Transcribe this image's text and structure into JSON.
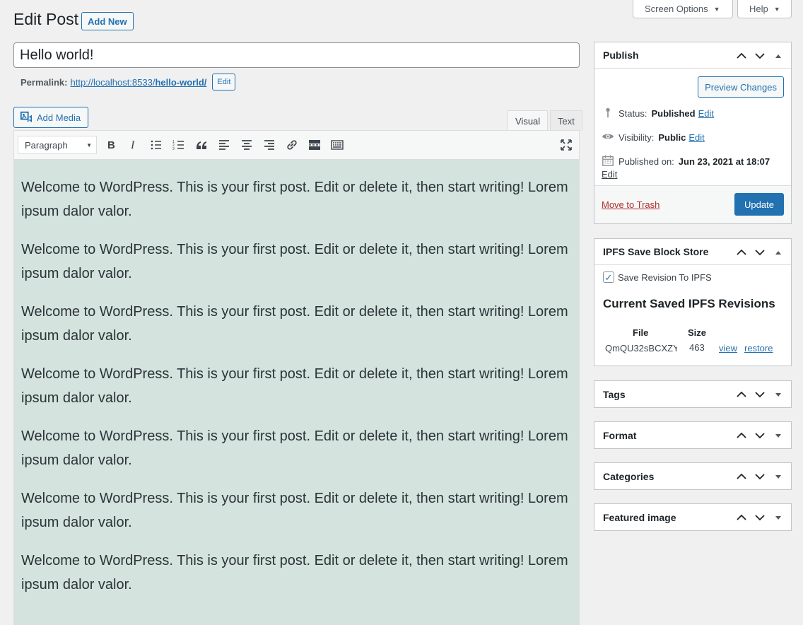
{
  "header": {
    "screen_options": "Screen Options",
    "help": "Help",
    "title": "Edit Post",
    "add_new": "Add New"
  },
  "post": {
    "title": "Hello world!",
    "permalink_label": "Permalink:",
    "permalink_base": "http://localhost:8533/",
    "permalink_slug": "hello-world/",
    "permalink_edit": "Edit"
  },
  "editor": {
    "add_media": "Add Media",
    "tab_visual": "Visual",
    "tab_text": "Text",
    "format_value": "Paragraph",
    "active_tab": "Visual",
    "paragraphs": [
      "Welcome to WordPress. This is your first post. Edit or delete it, then start writing! Lorem ipsum dalor valor.",
      "Welcome to WordPress. This is your first post. Edit or delete it, then start writing! Lorem ipsum dalor valor.",
      "Welcome to WordPress. This is your first post. Edit or delete it, then start writing! Lorem ipsum dalor valor.",
      "Welcome to WordPress. This is your first post. Edit or delete it, then start writing! Lorem ipsum dalor valor.",
      "Welcome to WordPress. This is your first post. Edit or delete it, then start writing! Lorem ipsum dalor valor.",
      "Welcome to WordPress. This is your first post. Edit or delete it, then start writing! Lorem ipsum dalor valor.",
      "Welcome to WordPress. This is your first post. Edit or delete it, then start writing! Lorem ipsum dalor valor."
    ],
    "toolbar_icons": [
      "bold-icon",
      "italic-icon",
      "bullet-list-icon",
      "numbered-list-icon",
      "blockquote-icon",
      "align-left-icon",
      "align-center-icon",
      "align-right-icon",
      "link-icon",
      "read-more-icon",
      "toolbar-toggle-icon",
      "fullscreen-icon"
    ]
  },
  "publish": {
    "title": "Publish",
    "preview": "Preview Changes",
    "status_label": "Status:",
    "status_value": "Published",
    "visibility_label": "Visibility:",
    "visibility_value": "Public",
    "published_label": "Published on:",
    "published_value": "Jun 23, 2021 at 18:07",
    "edit": "Edit",
    "trash": "Move to Trash",
    "update": "Update"
  },
  "ipfs": {
    "title": "IPFS Save Block Store",
    "checkbox_label": "Save Revision To IPFS",
    "checked": true,
    "heading": "Current Saved IPFS Revisions",
    "col_file": "File",
    "col_size": "Size",
    "row_file": "QmQU32sBCXZY",
    "row_size": "463",
    "view": "view",
    "restore": "restore"
  },
  "boxes": {
    "tags": "Tags",
    "format": "Format",
    "categories": "Categories",
    "featured": "Featured image"
  },
  "colors": {
    "accent": "#2271b1",
    "editor_bg": "#d4e3dd",
    "trash": "#b32d2e"
  }
}
